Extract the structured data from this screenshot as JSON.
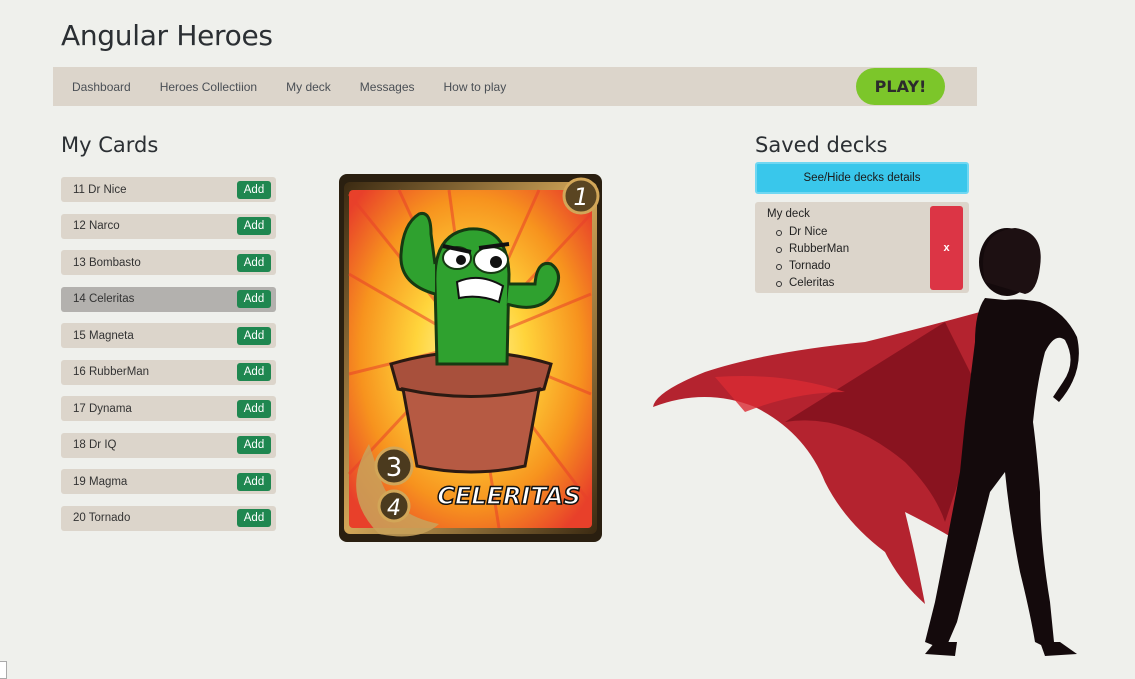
{
  "app": {
    "title": "Angular Heroes"
  },
  "nav": {
    "links": [
      "Dashboard",
      "Heroes Collectiion",
      "My deck",
      "Messages",
      "How to play"
    ],
    "play_label": "PLAY!"
  },
  "my_cards": {
    "title": "My Cards",
    "add_label": "Add",
    "items": [
      {
        "label": "11 Dr Nice"
      },
      {
        "label": "12 Narco"
      },
      {
        "label": "13 Bombasto"
      },
      {
        "label": "14 Celeritas",
        "selected": true
      },
      {
        "label": "15 Magneta"
      },
      {
        "label": "16 RubberMan"
      },
      {
        "label": "17 Dynama"
      },
      {
        "label": "18 Dr IQ"
      },
      {
        "label": "19 Magma"
      },
      {
        "label": "20 Tornado"
      }
    ]
  },
  "hero_card": {
    "name": "CELERITAS",
    "cost": "1",
    "attack": "3",
    "defense": "4"
  },
  "saved_decks": {
    "title": "Saved decks",
    "toggle_label": "See/Hide decks details",
    "decks": [
      {
        "name": "My deck",
        "cards": [
          "Dr Nice",
          "RubberMan",
          "Tornado",
          "Celeritas"
        ],
        "delete_label": "x"
      }
    ]
  },
  "colors": {
    "nav_bg": "#dcd5cb",
    "play_btn": "#7cc62a",
    "add_btn": "#1f8750",
    "toggle_btn": "#39c7eb",
    "delete_btn": "#dc3545"
  }
}
